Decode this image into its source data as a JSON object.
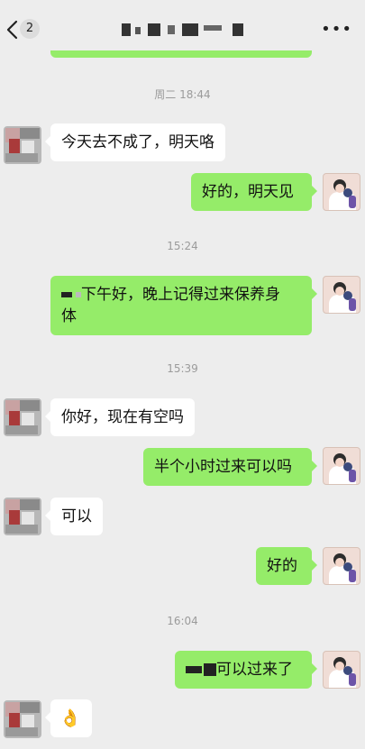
{
  "header": {
    "badge_count": "2"
  },
  "messages": [
    {
      "type": "time",
      "text": "周二 18:44"
    },
    {
      "type": "left",
      "text": "今天去不成了，明天咯"
    },
    {
      "type": "right",
      "text": "好的，明天见"
    },
    {
      "type": "time",
      "text": "15:24"
    },
    {
      "type": "right",
      "line1": "下午好，晚上记得过来保养身",
      "line2": "体"
    },
    {
      "type": "time",
      "text": "15:39"
    },
    {
      "type": "left",
      "text": "你好，现在有空吗"
    },
    {
      "type": "right",
      "text": "半个小时过来可以吗"
    },
    {
      "type": "left",
      "text": "可以"
    },
    {
      "type": "right",
      "text": "好的"
    },
    {
      "type": "time",
      "text": "16:04"
    },
    {
      "type": "right",
      "text": "可以过来了"
    },
    {
      "type": "left",
      "emoji": "👌"
    }
  ]
}
